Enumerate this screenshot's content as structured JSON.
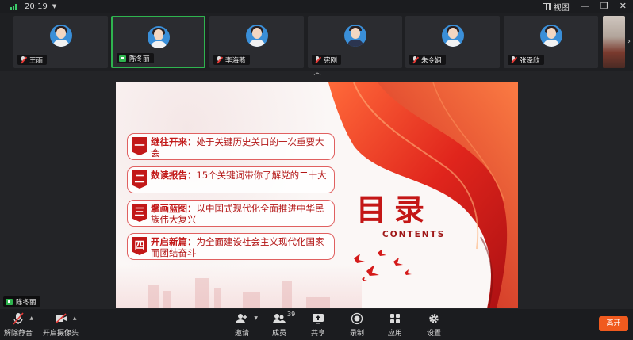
{
  "topbar": {
    "time": "20:19",
    "view_label": "视图",
    "minimize": "—",
    "restore": "❐",
    "close": "✕"
  },
  "participants": [
    {
      "name": "王雨",
      "muted": true,
      "active": false
    },
    {
      "name": "陈冬丽",
      "muted": false,
      "active": true
    },
    {
      "name": "李海燕",
      "muted": true,
      "active": false
    },
    {
      "name": "宪刚",
      "muted": true,
      "active": false
    },
    {
      "name": "朱令娴",
      "muted": true,
      "active": false
    },
    {
      "name": "张泽欣",
      "muted": true,
      "active": false
    }
  ],
  "speaker_name": "陈冬丽",
  "slide": {
    "title": "目录",
    "subtitle": "CONTENTS",
    "items": [
      {
        "num": "一",
        "heading": "继往开来：",
        "text": "处于关键历史关口的一次重要大会"
      },
      {
        "num": "二",
        "heading": "数读报告：",
        "text": "15个关键词带你了解党的二十大"
      },
      {
        "num": "三",
        "heading": "擘画蓝图：",
        "text": "以中国式现代化全面推进中华民族伟大复兴"
      },
      {
        "num": "四",
        "heading": "开启新篇：",
        "text": "为全面建设社会主义现代化国家而团结奋斗"
      }
    ]
  },
  "toolbar": {
    "unmute": "解除静音",
    "start_video": "开启摄像头",
    "invite": "邀请",
    "members": "成员",
    "member_count": "39",
    "share": "共享",
    "record": "录制",
    "apps": "应用",
    "settings": "设置",
    "leave": "离开"
  },
  "colors": {
    "accent_green": "#2fb44f",
    "leave_orange": "#f05a1e",
    "slide_red": "#c21818"
  }
}
